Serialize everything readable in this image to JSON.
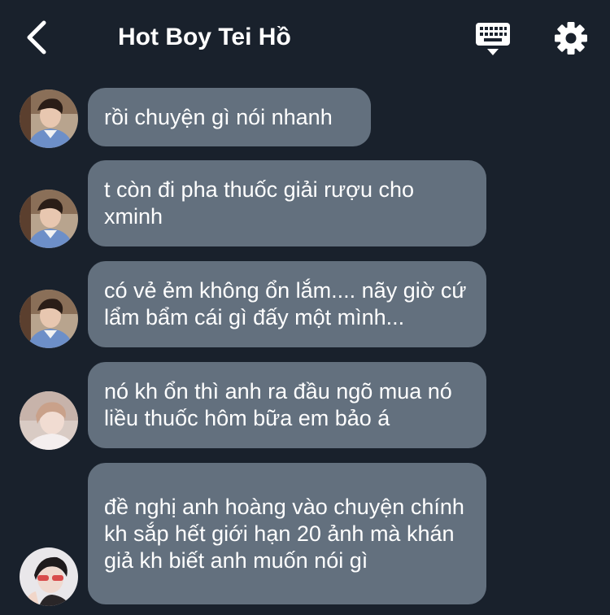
{
  "header": {
    "title": "Hot Boy Tei Hồ"
  },
  "icons": {
    "back": "chevron-left-icon",
    "keyboard": "keyboard-icon",
    "settings": "gear-icon"
  },
  "colors": {
    "background": "#19212c",
    "bubble": "#63707e",
    "text": "#ffffff"
  },
  "messages": [
    {
      "sender": "a",
      "text": "rồi chuyện gì nói nhanh"
    },
    {
      "sender": "a",
      "text": "t còn đi pha thuốc giải rượu cho xminh"
    },
    {
      "sender": "a",
      "text": "có vẻ ẻm không ổn lắm.... nãy giờ cứ lẩm bẩm cái gì đấy một mình..."
    },
    {
      "sender": "b",
      "text": "nó kh ổn thì anh ra đầu ngõ mua nó liều thuốc hôm bữa em bảo á"
    },
    {
      "sender": "c",
      "text": "đề nghị anh hoàng vào chuyện chính kh sắp hết giới hạn 20 ảnh mà khán giả kh biết anh muốn nói gì"
    }
  ]
}
